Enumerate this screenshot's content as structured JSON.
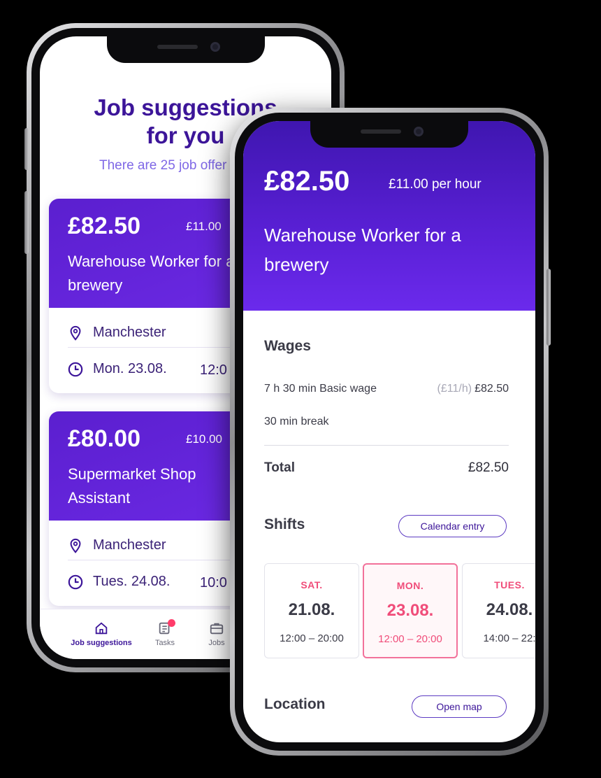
{
  "colors": {
    "brand_purple": "#5b1fcf",
    "dark_purple": "#3c1599",
    "accent_pink": "#f04d7a",
    "background": "#000000"
  },
  "back_phone": {
    "heading": "Job suggestions for you",
    "subheading": "There are 25 job offer",
    "jobs": [
      {
        "price": "£82.50",
        "rate": "£11.00",
        "title": "Warehouse Worker for a brewery",
        "location": "Manchester",
        "date": "Mon. 23.08.",
        "time": "12:0"
      },
      {
        "price": "£80.00",
        "rate": "£10.00",
        "title": "Supermarket Shop Assistant",
        "location": "Manchester",
        "date": "Tues. 24.08.",
        "time": "10:0"
      }
    ],
    "tabs": [
      {
        "label": "Job suggestions",
        "icon": "home-icon",
        "active": true
      },
      {
        "label": "Tasks",
        "icon": "tasks-icon",
        "badge": true
      },
      {
        "label": "Jobs",
        "icon": "briefcase-icon"
      }
    ]
  },
  "front_phone": {
    "price": "£82.50",
    "rate": "£11.00 per hour",
    "title": "Warehouse Worker for a brewery",
    "wages": {
      "title": "Wages",
      "rows": [
        {
          "label": "7 h 30 min Basic wage",
          "note": "(£11/h)",
          "amount": "£82.50"
        },
        {
          "label": "30 min break",
          "note": "",
          "amount": ""
        }
      ],
      "total_label": "Total",
      "total_amount": "£82.50"
    },
    "shifts": {
      "title": "Shifts",
      "calendar_button": "Calendar entry",
      "items": [
        {
          "day": "SAT.",
          "date": "21.08.",
          "hours": "12:00 – 20:00",
          "selected": false
        },
        {
          "day": "MON.",
          "date": "23.08.",
          "hours": "12:00 – 20:00",
          "selected": true
        },
        {
          "day": "TUES.",
          "date": "24.08.",
          "hours": "14:00 – 22:",
          "selected": false
        }
      ]
    },
    "location": {
      "title": "Location",
      "map_button": "Open map"
    }
  }
}
